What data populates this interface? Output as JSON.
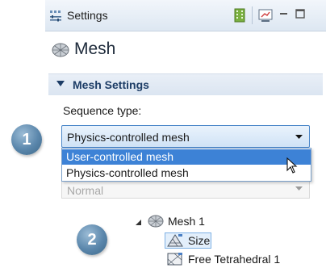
{
  "titlebar": {
    "title": "Settings"
  },
  "header": {
    "title": "Mesh"
  },
  "section": {
    "label": "Mesh Settings"
  },
  "sequence": {
    "label": "Sequence type:",
    "selected": "Physics-controlled mesh",
    "options": [
      "User-controlled mesh",
      "Physics-controlled mesh"
    ],
    "highlighted": "User-controlled mesh"
  },
  "element_size": {
    "value": "Normal"
  },
  "steps": [
    "1",
    "2"
  ],
  "tree": {
    "root": "Mesh 1",
    "children": [
      "Size",
      "Free Tetrahedral 1"
    ]
  },
  "colors": {
    "accent": "#3d82d6",
    "badge": "#5a86ab",
    "section_text": "#1d3d66"
  }
}
